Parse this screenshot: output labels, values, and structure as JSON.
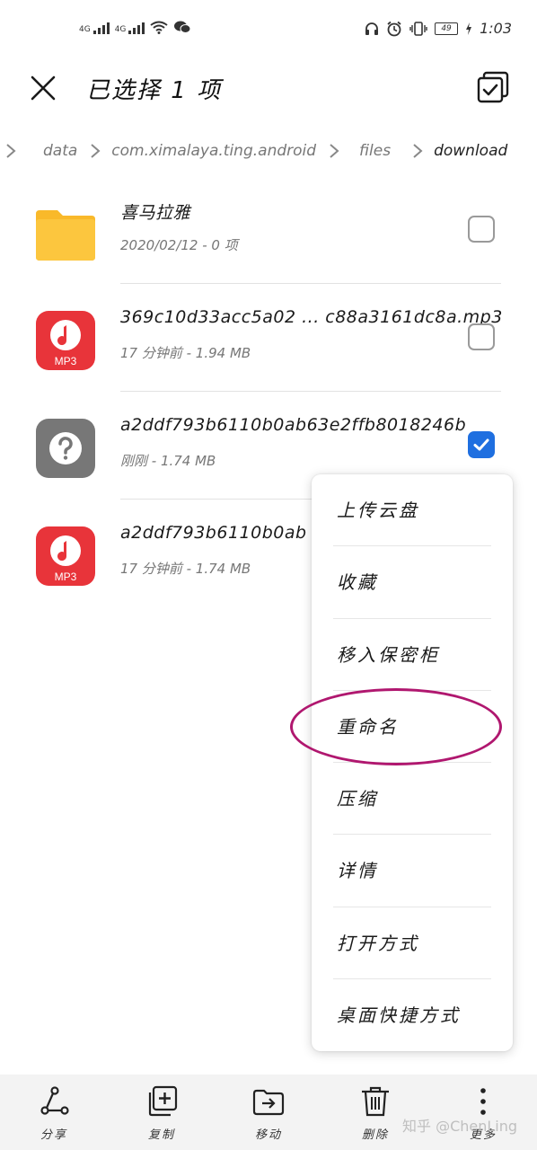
{
  "status_bar": {
    "signal_labels": [
      "4G",
      "4G"
    ],
    "battery": "49",
    "time": "1:03",
    "icons": [
      "wifi-icon",
      "wechat-icon",
      "headset-icon",
      "alarm-icon",
      "vibrate-icon",
      "battery-icon",
      "charging-icon"
    ]
  },
  "header": {
    "title": "已选择 1 项",
    "icons": [
      "close-icon",
      "select-all-icon"
    ]
  },
  "breadcrumb": [
    "data",
    "com.ximalaya.ting.android",
    "files",
    "download"
  ],
  "files": [
    {
      "name": "喜马拉雅",
      "meta": "2020/02/12 - 0 项",
      "icon": "folder-icon",
      "checked": false
    },
    {
      "name": "369c10d33acc5a02 ... c88a3161dc8a.mp3",
      "meta": "17 分钟前 - 1.94 MB",
      "icon": "mp3-icon",
      "icon_text": "MP3",
      "checked": false
    },
    {
      "name": "a2ddf793b6110b0ab63e2ffb8018246b",
      "meta": "刚刚 - 1.74 MB",
      "icon": "unknown-file-icon",
      "checked": true
    },
    {
      "name": "a2ddf793b6110b0ab ... f",
      "meta": "17 分钟前 - 1.74 MB",
      "icon": "mp3-icon",
      "icon_text": "MP3",
      "checked": false
    }
  ],
  "context_menu": [
    "上传云盘",
    "收藏",
    "移入保密柜",
    "重命名",
    "压缩",
    "详情",
    "打开方式",
    "桌面快捷方式"
  ],
  "bottom_bar": [
    {
      "label": "分享",
      "icon": "share-icon"
    },
    {
      "label": "复制",
      "icon": "copy-icon"
    },
    {
      "label": "移动",
      "icon": "move-icon"
    },
    {
      "label": "删除",
      "icon": "delete-icon"
    },
    {
      "label": "更多",
      "icon": "more-icon"
    }
  ],
  "watermark": "知乎 @ChenLing",
  "colors": {
    "accent": "#1f6fe0",
    "folder": "#f9b92a",
    "mp3": "#e8343a",
    "highlight": "#b0176f"
  }
}
